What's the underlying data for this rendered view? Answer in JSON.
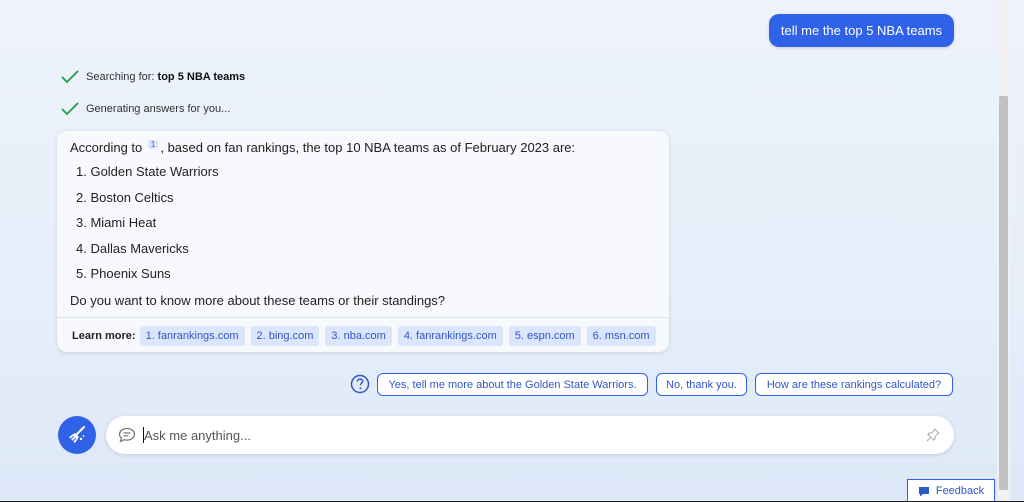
{
  "user_message": "tell me the top 5 NBA teams",
  "status": {
    "searching_prefix": "Searching for: ",
    "searching_query": "top 5 NBA teams",
    "generating": "Generating answers for you..."
  },
  "answer": {
    "intro_before": "According to",
    "citation": "1",
    "intro_after": ", based on fan rankings, the top 10 NBA teams as of February 2023 are:",
    "list": [
      "1. Golden State Warriors",
      "2. Boston Celtics",
      "3. Miami Heat",
      "4. Dallas Mavericks",
      "5. Phoenix Suns"
    ],
    "outro": "Do you want to know more about these teams or their standings?"
  },
  "learn_more": {
    "label": "Learn more:",
    "links": [
      "1. fanrankings.com",
      "2. bing.com",
      "3. nba.com",
      "4. fanrankings.com",
      "5. espn.com",
      "6. msn.com"
    ]
  },
  "suggestions": [
    "Yes, tell me more about the Golden State Warriors.",
    "No, thank you.",
    "How are these rankings calculated?"
  ],
  "input": {
    "placeholder": "Ask me anything..."
  },
  "feedback_label": "Feedback",
  "colors": {
    "accent": "#2f62e6",
    "check": "#1e9e3f"
  }
}
